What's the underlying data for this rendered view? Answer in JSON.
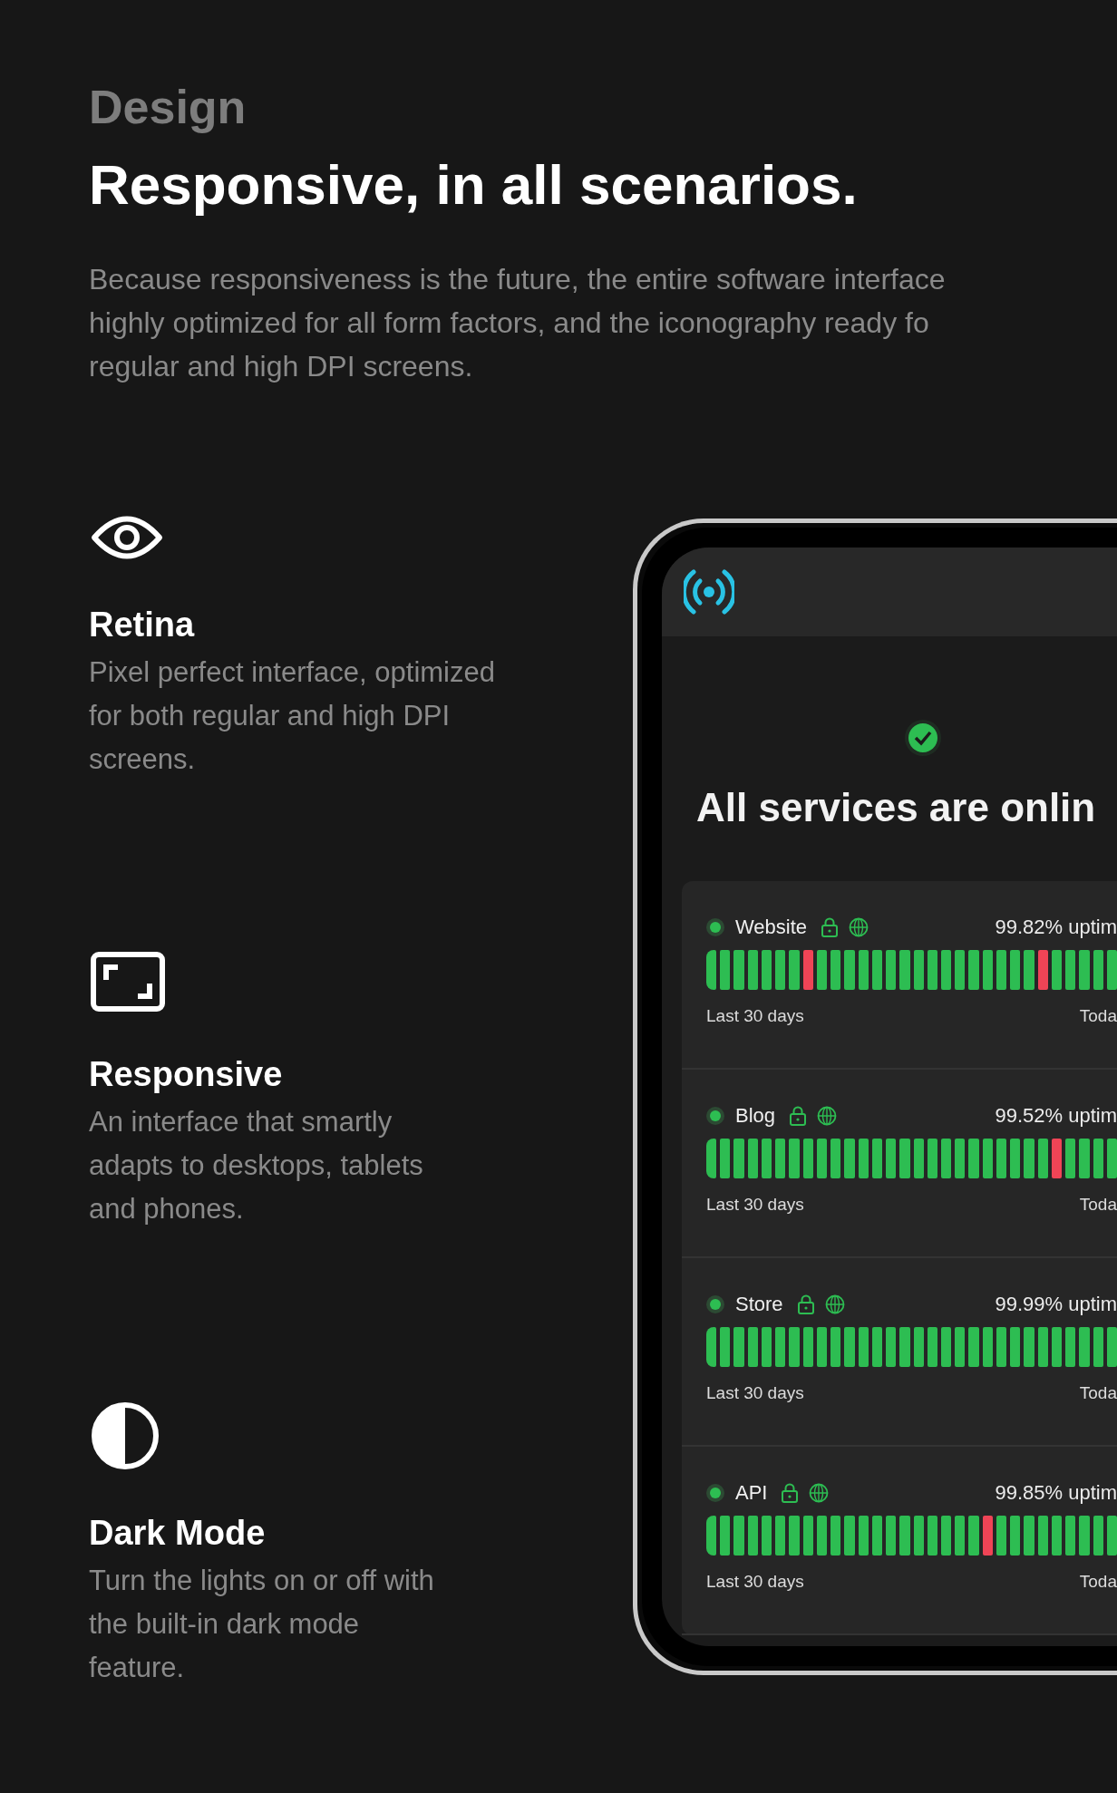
{
  "section": {
    "eyebrow": "Design",
    "title": "Responsive, in all scenarios.",
    "intro": "Because responsiveness is the future, the entire software interface\nhighly optimized for all form factors, and the iconography ready fo\nregular and high DPI screens."
  },
  "features": [
    {
      "kind": "eye",
      "title": "Retina",
      "text": "Pixel perfect interface, optimized\nfor both regular and high DPI\nscreens."
    },
    {
      "kind": "frame",
      "title": "Responsive",
      "text": "An interface that smartly\nadapts to desktops, tablets\nand phones."
    },
    {
      "kind": "contrast",
      "title": "Dark Mode",
      "text": "Turn the lights on or off with\nthe built-in dark mode\nfeature."
    }
  ],
  "phone": {
    "headline": "All services are onlin",
    "services": [
      {
        "name": "Website",
        "uptime": "99.82% uptim",
        "range_start": "Last 30 days",
        "range_end": "Toda",
        "down": [
          false,
          false,
          false,
          false,
          false,
          false,
          false,
          true,
          false,
          false,
          false,
          false,
          false,
          false,
          false,
          false,
          false,
          false,
          false,
          false,
          false,
          false,
          false,
          false,
          true,
          false,
          false,
          false,
          false,
          false
        ]
      },
      {
        "name": "Blog",
        "uptime": "99.52% uptim",
        "range_start": "Last 30 days",
        "range_end": "Toda",
        "down": [
          false,
          false,
          false,
          false,
          false,
          false,
          false,
          false,
          false,
          false,
          false,
          false,
          false,
          false,
          false,
          false,
          false,
          false,
          false,
          false,
          false,
          false,
          false,
          false,
          false,
          true,
          false,
          false,
          false,
          false
        ]
      },
      {
        "name": "Store",
        "uptime": "99.99% uptim",
        "range_start": "Last 30 days",
        "range_end": "Toda",
        "down": [
          false,
          false,
          false,
          false,
          false,
          false,
          false,
          false,
          false,
          false,
          false,
          false,
          false,
          false,
          false,
          false,
          false,
          false,
          false,
          false,
          false,
          false,
          false,
          false,
          false,
          false,
          false,
          false,
          false,
          false
        ]
      },
      {
        "name": "API",
        "uptime": "99.85% uptim",
        "range_start": "Last 30 days",
        "range_end": "Toda",
        "down": [
          false,
          false,
          false,
          false,
          false,
          false,
          false,
          false,
          false,
          false,
          false,
          false,
          false,
          false,
          false,
          false,
          false,
          false,
          false,
          false,
          true,
          false,
          false,
          false,
          false,
          false,
          false,
          false,
          false,
          false
        ]
      }
    ]
  }
}
